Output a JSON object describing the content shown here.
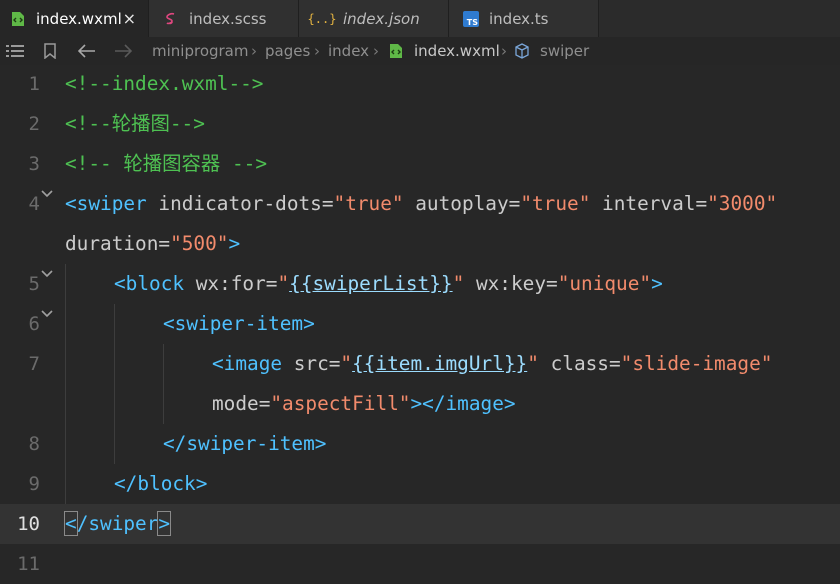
{
  "tabs": [
    {
      "label": "index.wxml",
      "icon": "wxml-file-icon",
      "active": true,
      "close": "×"
    },
    {
      "label": "index.scss",
      "icon": "sass-file-icon",
      "active": false
    },
    {
      "label": "index.json",
      "icon": "json-file-icon",
      "active": false,
      "icon_text": "{..}"
    },
    {
      "label": "index.ts",
      "icon": "typescript-file-icon",
      "active": false,
      "icon_text": "TS"
    }
  ],
  "breadcrumb": {
    "items": [
      "miniprogram",
      "pages",
      "index",
      "index.wxml",
      "swiper"
    ],
    "separator": "›"
  },
  "colors": {
    "tag": "#4fc1ff",
    "attribute": "#cccccc",
    "string": "#f28b6c",
    "comment": "#4ec152",
    "background": "#272727"
  },
  "editor": {
    "current_line": 10,
    "lines": [
      {
        "n": "1",
        "tokens": [
          [
            "cmt",
            "<!--index.wxml-->"
          ]
        ]
      },
      {
        "n": "2",
        "tokens": [
          [
            "cmt",
            "<!--轮播图-->"
          ]
        ]
      },
      {
        "n": "3",
        "tokens": [
          [
            "cmt",
            "<!-- 轮播图容器 -->"
          ]
        ]
      },
      {
        "n": "4",
        "tokens": [
          [
            "tag",
            "<swiper"
          ],
          [
            "attr",
            " indicator-dots="
          ],
          [
            "str",
            "\"true\""
          ],
          [
            "attr",
            " autoplay="
          ],
          [
            "str",
            "\"true\""
          ],
          [
            "attr",
            " interval="
          ],
          [
            "str",
            "\"3000\""
          ]
        ]
      },
      {
        "n": "",
        "tokens": [
          [
            "attr",
            "duration="
          ],
          [
            "str",
            "\"500\""
          ],
          [
            "tag",
            ">"
          ]
        ]
      },
      {
        "n": "5",
        "tokens": [
          [
            "tag",
            "<block"
          ],
          [
            "attr",
            " wx:for="
          ],
          [
            "str",
            "\""
          ],
          [
            "mus",
            "{{swiperList}}"
          ],
          [
            "str",
            "\""
          ],
          [
            "attr",
            " wx:key="
          ],
          [
            "str",
            "\"unique\""
          ],
          [
            "tag",
            ">"
          ]
        ]
      },
      {
        "n": "6",
        "tokens": [
          [
            "tag",
            "<swiper-item>"
          ]
        ]
      },
      {
        "n": "7",
        "tokens": [
          [
            "tag",
            "<image"
          ],
          [
            "attr",
            " src="
          ],
          [
            "str",
            "\""
          ],
          [
            "mus",
            "{{item.imgUrl}}"
          ],
          [
            "str",
            "\""
          ],
          [
            "attr",
            " class="
          ],
          [
            "str",
            "\"slide-image\""
          ]
        ]
      },
      {
        "n": "",
        "tokens": [
          [
            "attr",
            "mode="
          ],
          [
            "str",
            "\"aspectFill\""
          ],
          [
            "tag",
            "></image>"
          ]
        ]
      },
      {
        "n": "8",
        "tokens": [
          [
            "tag",
            "</swiper-item>"
          ]
        ]
      },
      {
        "n": "9",
        "tokens": [
          [
            "tag",
            "</block>"
          ]
        ]
      },
      {
        "n": "10",
        "tokens": [
          [
            "tag",
            "</swiper>"
          ]
        ]
      },
      {
        "n": "11",
        "tokens": []
      }
    ]
  }
}
